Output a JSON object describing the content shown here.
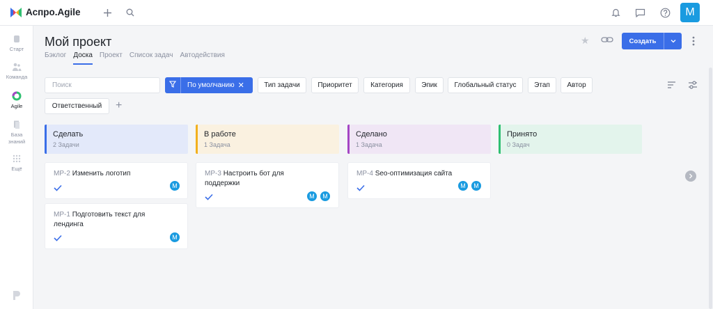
{
  "app": {
    "title": "Аспро.Agile",
    "user_initial": "М"
  },
  "sidebar": {
    "items": [
      {
        "label": "Старт",
        "icon": "hand-icon"
      },
      {
        "label": "Команда",
        "icon": "team-icon"
      },
      {
        "label": "Agile",
        "icon": "agile-icon"
      },
      {
        "label": "База знаний",
        "icon": "book-icon"
      },
      {
        "label": "Ещё",
        "icon": "grid-icon"
      }
    ]
  },
  "header": {
    "title": "Мой проект",
    "tabs": [
      "Бэклог",
      "Доска",
      "Проект",
      "Список задач",
      "Автодействия"
    ],
    "active_tab": "Доска",
    "create_label": "Создать"
  },
  "filters": {
    "search_placeholder": "Поиск",
    "default_filter": "По умолчанию",
    "chips": [
      "Тип задачи",
      "Приоритет",
      "Категория",
      "Эпик",
      "Глобальный статус",
      "Этап",
      "Автор",
      "Ответственный"
    ]
  },
  "columns": [
    {
      "name": "Сделать",
      "count": "2 Задачи",
      "color": "#e3e9fa",
      "accent": "#3a6ee8",
      "cards": [
        {
          "key": "МР-2",
          "title": "Изменить логотип",
          "avatars": [
            "М"
          ]
        },
        {
          "key": "МР-1",
          "title": "Подготовить текст для лендинга",
          "avatars": [
            "М"
          ]
        }
      ]
    },
    {
      "name": "В работе",
      "count": "1 Задача",
      "color": "#faf1e0",
      "accent": "#f2b01e",
      "cards": [
        {
          "key": "МР-3",
          "title": "Настроить бот для поддержки",
          "avatars": [
            "М",
            "М"
          ]
        }
      ]
    },
    {
      "name": "Сделано",
      "count": "1 Задача",
      "color": "#f0e6f5",
      "accent": "#a446c4",
      "cards": [
        {
          "key": "МР-4",
          "title": "Seo-оптимизация сайта",
          "avatars": [
            "М",
            "М"
          ]
        }
      ]
    },
    {
      "name": "Принято",
      "count": "0 Задач",
      "color": "#e3f4ec",
      "accent": "#2fbf71",
      "cards": []
    }
  ],
  "colors": {
    "brand": "#3a6ee8",
    "avatar": "#1a9be0"
  }
}
